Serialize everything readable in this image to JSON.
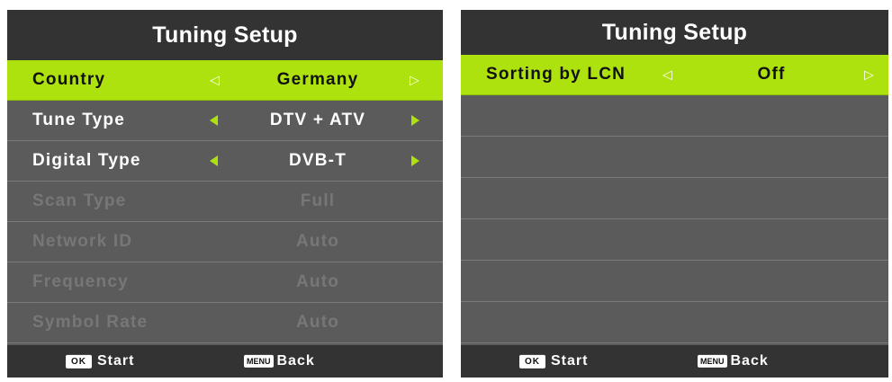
{
  "left_panel": {
    "title": "Tuning Setup",
    "rows": [
      {
        "label": "Country",
        "value": "Germany"
      },
      {
        "label": "Tune Type",
        "value": "DTV + ATV"
      },
      {
        "label": "Digital Type",
        "value": "DVB-T"
      },
      {
        "label": "Scan Type",
        "value": "Full"
      },
      {
        "label": "Network ID",
        "value": "Auto"
      },
      {
        "label": "Frequency",
        "value": "Auto"
      },
      {
        "label": "Symbol Rate",
        "value": "Auto"
      }
    ],
    "footer": {
      "ok_key": "OK",
      "start": "Start",
      "menu_key": "MENU",
      "back": "Back"
    }
  },
  "right_panel": {
    "title": "Tuning Setup",
    "rows": [
      {
        "label": "Sorting by LCN",
        "value": "Off"
      }
    ],
    "footer": {
      "ok_key": "OK",
      "start": "Start",
      "menu_key": "MENU",
      "back": "Back"
    }
  },
  "colors": {
    "highlight": "#aee20e",
    "panel": "#5b5b5b",
    "header": "#333333",
    "disabled_text": "#777777"
  }
}
